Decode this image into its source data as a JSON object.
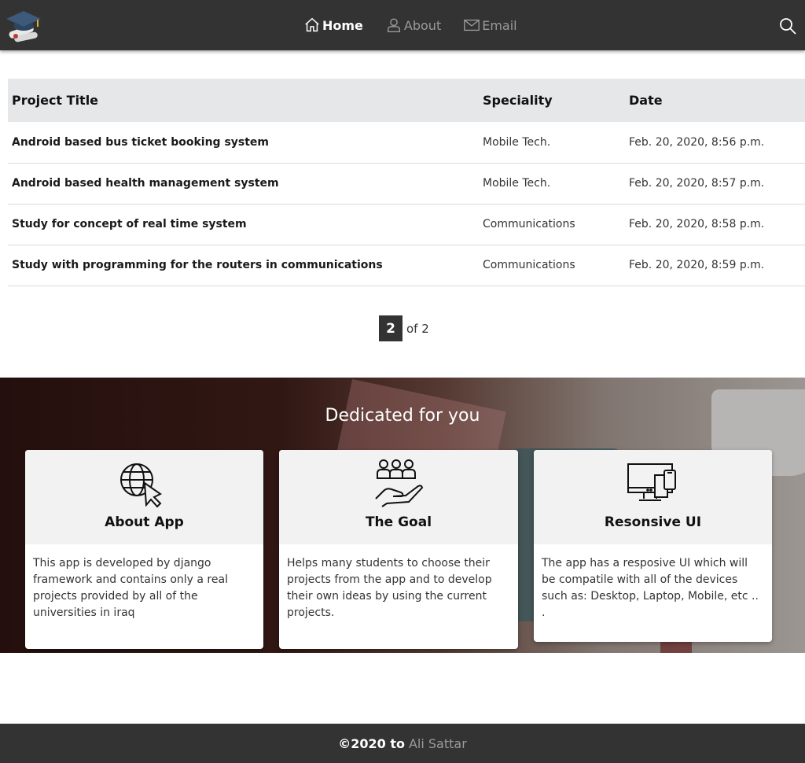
{
  "navbar": {
    "logo_icon": "graduation-cap-icon",
    "links": [
      {
        "label": "Home",
        "icon": "home-icon",
        "active": true
      },
      {
        "label": "About",
        "icon": "user-icon",
        "active": false
      },
      {
        "label": "Email",
        "icon": "envelope-icon",
        "active": false
      }
    ],
    "search_icon": "search-icon"
  },
  "table": {
    "headers": [
      "Project Title",
      "Speciality",
      "Date"
    ],
    "rows": [
      {
        "title": "Android based bus ticket booking system",
        "speciality": "Mobile Tech.",
        "date": "Feb. 20, 2020, 8:56 p.m."
      },
      {
        "title": "Android based health management system",
        "speciality": "Mobile Tech.",
        "date": "Feb. 20, 2020, 8:57 p.m."
      },
      {
        "title": "Study for concept of real time system",
        "speciality": "Communications",
        "date": "Feb. 20, 2020, 8:58 p.m."
      },
      {
        "title": "Study with programming for the routers in communications",
        "speciality": "Communications",
        "date": "Feb. 20, 2020, 8:59 p.m."
      }
    ]
  },
  "pagination": {
    "current": "2",
    "of_text": "of 2"
  },
  "hero": {
    "title": "Dedicated for you",
    "cards": [
      {
        "title": "About App",
        "icon": "globe-cursor-icon",
        "text": "This app is developed by django framework and contains only a real projects provided by all of the universities in iraq"
      },
      {
        "title": "The Goal",
        "icon": "hand-group-icon",
        "text": "Helps many students to choose their projects from the app and to develop their own ideas by using the current projects."
      },
      {
        "title": "Resonsive UI",
        "icon": "devices-icon",
        "text": "The app has a resposive UI which will be compatile with all of the devices such as: Desktop, Laptop, Mobile, etc .. ."
      }
    ]
  },
  "footer": {
    "copyright": "©2020 to",
    "author": "Ali Sattar"
  },
  "colors": {
    "navbar": "#333333",
    "table_header": "#e6e7e8",
    "card_head": "#f2f2f2",
    "muted_text": "#9a9a9a"
  }
}
